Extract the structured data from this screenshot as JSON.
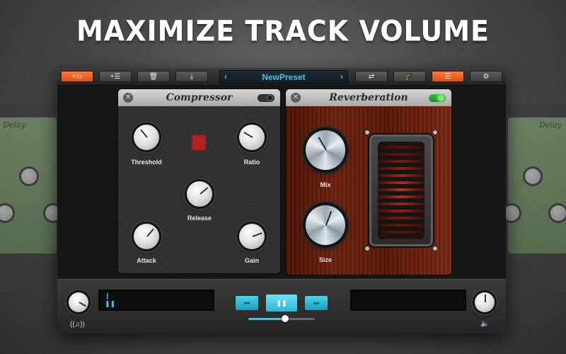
{
  "headline": "MAXIMIZE TRACK VOLUME",
  "toolbar": {
    "left_buttons": [
      {
        "label": "+▭",
        "icon": "add-effect-icon",
        "active": true
      },
      {
        "label": "+☰",
        "icon": "add-list-icon"
      },
      {
        "label": "🗑",
        "icon": "trash-icon"
      },
      {
        "label": "⤓",
        "icon": "download-icon"
      }
    ],
    "preset": {
      "name": "NewPreset",
      "prev": "‹",
      "next": "›"
    },
    "right_buttons": [
      {
        "label": "⇄",
        "icon": "routing-icon"
      },
      {
        "label": "🎓",
        "icon": "tutorial-icon"
      },
      {
        "label": "☰",
        "icon": "list-icon",
        "active": true
      },
      {
        "label": "⚙",
        "icon": "gear-icon"
      }
    ]
  },
  "compressor": {
    "title": "Compressor",
    "close": "✕",
    "enabled": false,
    "knobs": {
      "threshold": "Threshold",
      "ratio": "Ratio",
      "release": "Release",
      "attack": "Attack",
      "gain": "Gain"
    }
  },
  "reverb": {
    "title": "Reverberation",
    "close": "✕",
    "enabled": true,
    "knobs": {
      "mix": "Mix",
      "size": "Size"
    }
  },
  "ghost_left": {
    "title": "Delay"
  },
  "ghost_right": {
    "title": "Delay"
  },
  "transport": {
    "prev": "⏮",
    "pause": "❚❚",
    "next": "⏭",
    "progress": 0.55
  },
  "bottom": {
    "left_icon": "((♫))",
    "right_icon": "🔈",
    "left_lcd_mark": "❙\n❚❚"
  },
  "colors": {
    "accent": "#48c2dc",
    "orange": "#e24e12",
    "green_toggle": "#34c43a"
  }
}
